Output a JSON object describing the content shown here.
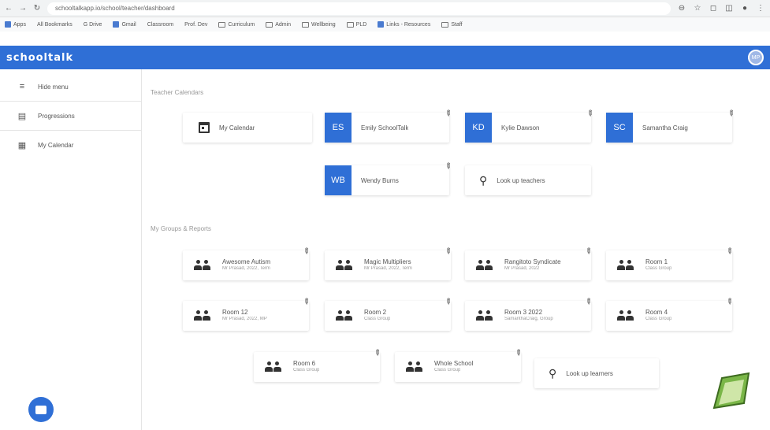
{
  "browser": {
    "url": "schooltalkapp.io/school/teacher/dashboard"
  },
  "bookmarks": [
    "Apps",
    "All Bookmarks",
    "G Drive",
    "Gmail",
    "Classroom",
    "Prof. Dev",
    "Curriculum",
    "Admin",
    "Wellbeing",
    "PLD",
    "Links - Resources",
    "Staff"
  ],
  "app": {
    "logo": "schooltalk",
    "avatar": "MP"
  },
  "sidebar": {
    "items": [
      {
        "icon": "menu-icon",
        "label": "Hide menu"
      },
      {
        "icon": "list-icon",
        "label": "Progressions"
      },
      {
        "icon": "calendar-icon",
        "label": "My Calendar"
      }
    ]
  },
  "teacher_calendars": {
    "label": "Teacher Calendars",
    "my_calendar": "My Calendar",
    "teachers": [
      {
        "initials": "ES",
        "name": "Emily SchoolTalk"
      },
      {
        "initials": "KD",
        "name": "Kylie Dawson"
      },
      {
        "initials": "SC",
        "name": "Samantha Craig"
      },
      {
        "initials": "WB",
        "name": "Wendy Burns"
      }
    ],
    "lookup": "Look up teachers"
  },
  "groups": {
    "label": "My Groups & Reports",
    "items": [
      {
        "name": "Awesome Autism",
        "sub": "Mr Prasad, 2022, Term"
      },
      {
        "name": "Magic Multipliers",
        "sub": "Mr Prasad, 2022, Term"
      },
      {
        "name": "Rangitoto Syndicate",
        "sub": "Mr Prasad, 2022"
      },
      {
        "name": "Room 1",
        "sub": "Class Group"
      },
      {
        "name": "Room 12",
        "sub": "Mr Prasad, 2022, MP"
      },
      {
        "name": "Room 2",
        "sub": "Class Group"
      },
      {
        "name": "Room 3 2022",
        "sub": "SamanthaCraig, Group"
      },
      {
        "name": "Room 4",
        "sub": "Class Group"
      },
      {
        "name": "Room 6",
        "sub": "Class Group"
      },
      {
        "name": "Whole School",
        "sub": "Class Group"
      }
    ],
    "lookup": "Look up learners"
  }
}
